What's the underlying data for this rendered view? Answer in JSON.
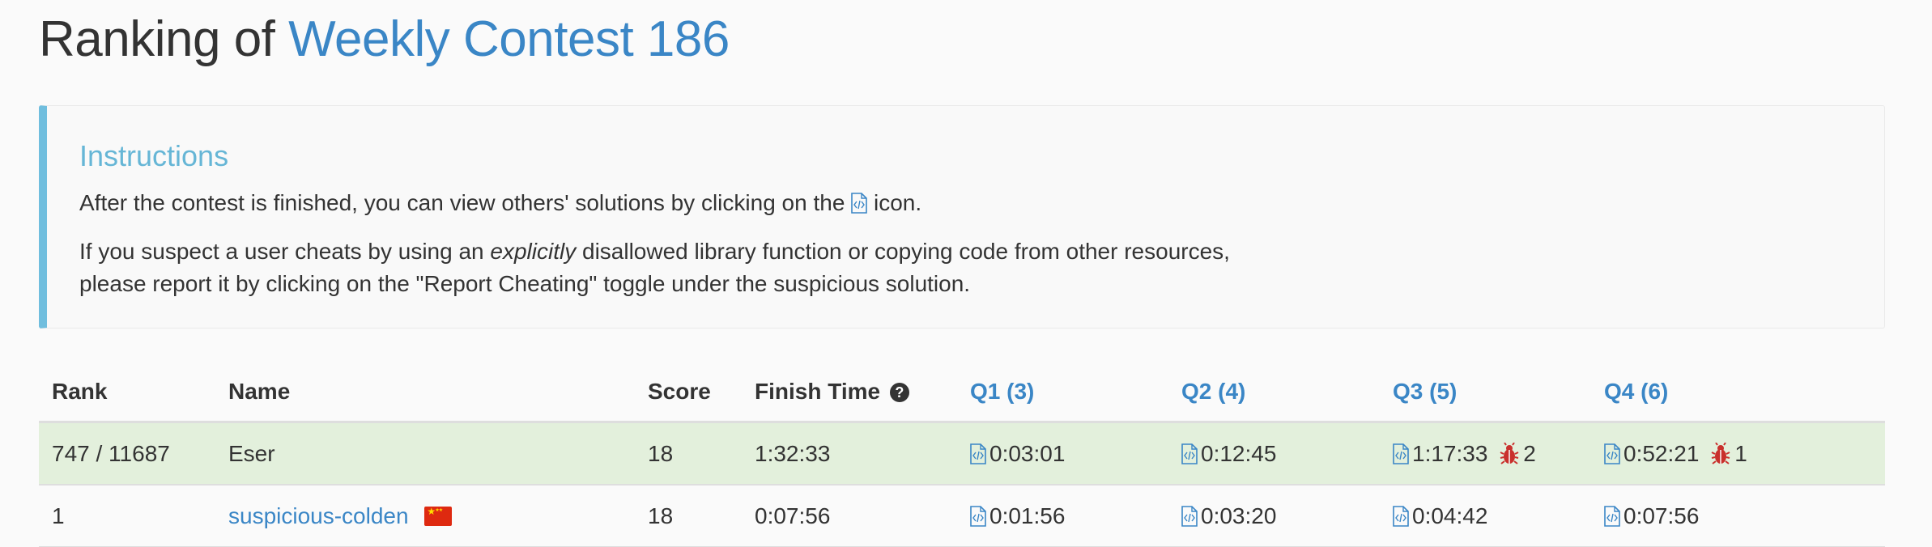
{
  "header": {
    "title_prefix": "Ranking of",
    "contest_name": "Weekly Contest 186"
  },
  "instructions": {
    "heading": "Instructions",
    "line1_before": "After the contest is finished, you can view others' solutions by clicking on the",
    "line1_after": "icon.",
    "line2_before": "If you suspect a user cheats by using an",
    "line2_emphasis": "explicitly",
    "line2_after": "disallowed library function or copying code from other resources,",
    "line3": "please report it by clicking on the \"Report Cheating\" toggle under the suspicious solution."
  },
  "table": {
    "columns": {
      "rank": "Rank",
      "name": "Name",
      "score": "Score",
      "finish_time": "Finish Time",
      "q1": "Q1 (3)",
      "q2": "Q2 (4)",
      "q3": "Q3 (5)",
      "q4": "Q4 (6)"
    },
    "rows": [
      {
        "rank": "747 / 11687",
        "name": "Eser",
        "score": "18",
        "finish_time": "1:32:33",
        "q1": "0:03:01",
        "q2": "0:12:45",
        "q3": "1:17:33",
        "q3_bugs": "2",
        "q4": "0:52:21",
        "q4_bugs": "1"
      },
      {
        "rank": "1",
        "name": "suspicious-colden",
        "score": "18",
        "finish_time": "0:07:56",
        "q1": "0:01:56",
        "q2": "0:03:20",
        "q3": "0:04:42",
        "q4": "0:07:56"
      }
    ]
  },
  "colors": {
    "accent": "#3a86c6",
    "instructions_border": "#70bede",
    "self_row_bg": "#e3f0dc",
    "bug": "#c9302c"
  },
  "icons": {
    "solution": "code-file-icon",
    "help": "question-circle-icon",
    "wrong_answer": "bug-icon",
    "country": "china-flag-icon"
  }
}
